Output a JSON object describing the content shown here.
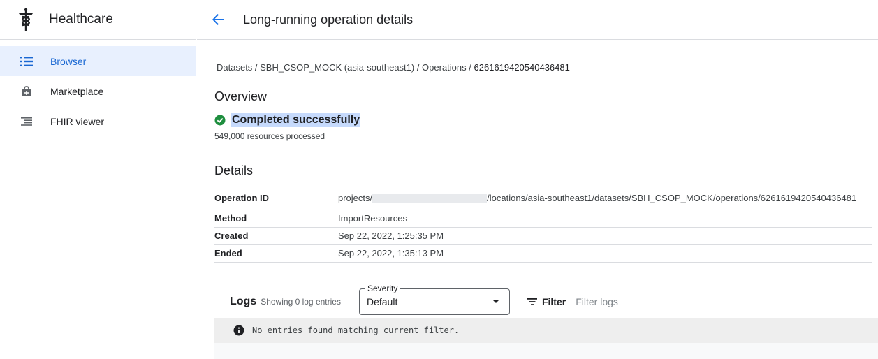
{
  "sidebar": {
    "product_name": "Healthcare",
    "product_icon": "caduceus-icon",
    "items": [
      {
        "label": "Browser",
        "icon": "list-icon",
        "active": true
      },
      {
        "label": "Marketplace",
        "icon": "bag-icon",
        "active": false
      },
      {
        "label": "FHIR viewer",
        "icon": "tree-list-icon",
        "active": false
      }
    ]
  },
  "header": {
    "title": "Long-running operation details",
    "back_icon": "arrow-back-icon"
  },
  "breadcrumb": {
    "path": "Datasets / SBH_CSOP_MOCK (asia-southeast1) / Operations / ",
    "current": "6261619420540436481"
  },
  "overview": {
    "heading": "Overview",
    "status": "Completed successfully",
    "resources": "549,000 resources processed"
  },
  "details": {
    "heading": "Details",
    "rows": [
      {
        "key": "Operation ID",
        "value_prefix": "projects/",
        "value_suffix": "/locations/asia-southeast1/datasets/SBH_CSOP_MOCK/operations/6261619420540436481"
      },
      {
        "key": "Method",
        "value": "ImportResources"
      },
      {
        "key": "Created",
        "value": "Sep 22, 2022, 1:25:35 PM"
      },
      {
        "key": "Ended",
        "value": "Sep 22, 2022, 1:35:13 PM"
      }
    ]
  },
  "logs": {
    "title": "Logs",
    "count": "Showing 0 log entries",
    "severity_label": "Severity",
    "severity_value": "Default",
    "filter_label": "Filter",
    "filter_placeholder": "Filter logs",
    "empty_message": "No entries found matching current filter."
  },
  "colors": {
    "accent": "#1a73e8",
    "success": "#1e8e3e",
    "highlight": "#c6dafc"
  }
}
